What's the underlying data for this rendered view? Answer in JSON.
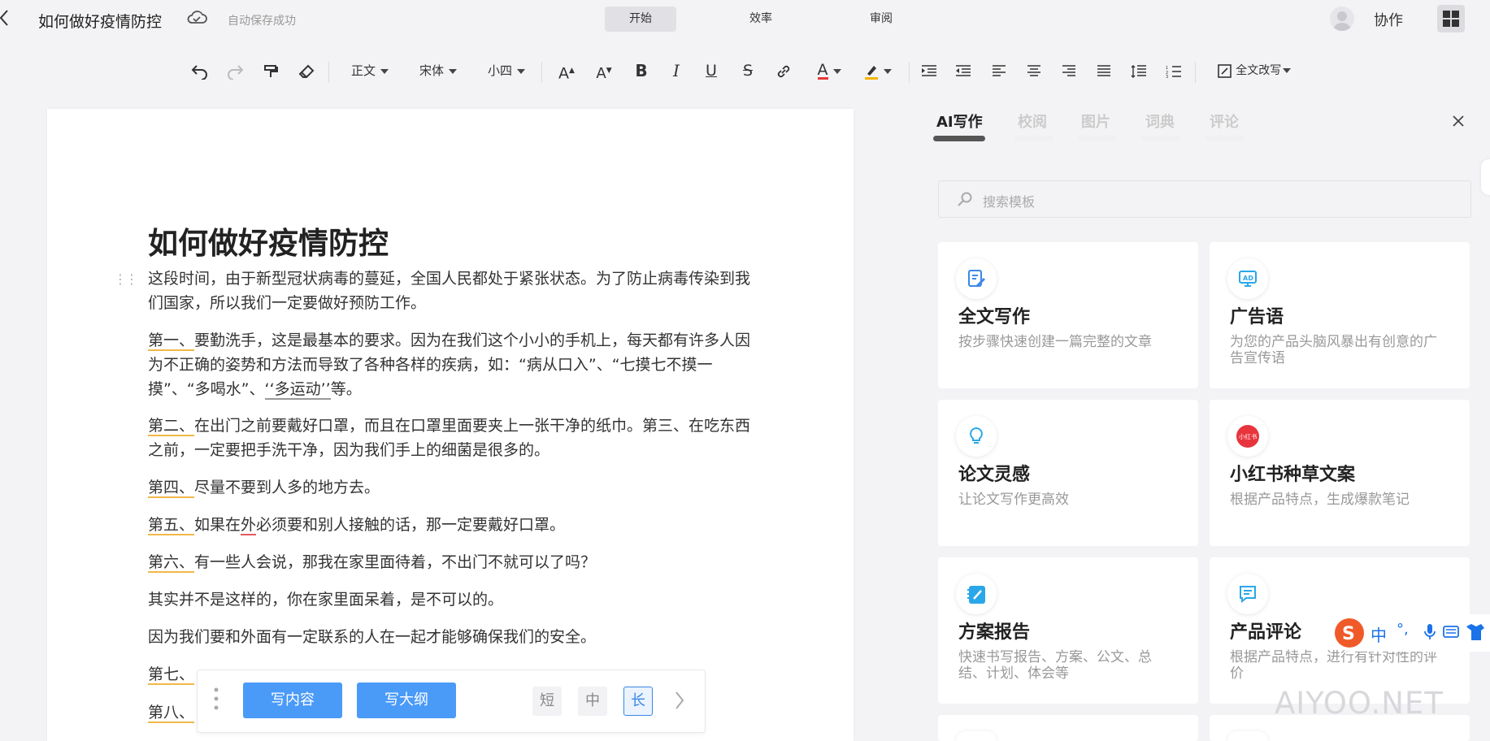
{
  "header": {
    "doc_title": "如何做好疫情防控",
    "save_status": "自动保存成功",
    "tabs": [
      "开始",
      "效率",
      "审阅"
    ],
    "collab": "协作"
  },
  "toolbar": {
    "style": "正文",
    "font": "宋体",
    "size": "小四",
    "rewrite": "全文改写",
    "font_color": "#e53935",
    "highlight_color": "#f5b400"
  },
  "document": {
    "title": "如何做好疫情防控",
    "p1": "这段时间，由于新型冠状病毒的蔓延，全国人民都处于紧张状态。为了防止病毒传染到我们国家，所以我们一定要做好预防工作。",
    "p2a": "第一、",
    "p2b": "要勤洗手，这是最基本的要求。因为在我们这个小小的手机上，每天都有许多人因为不正确的姿势和方法而导致了各种各样的疾病，如：“病从口入”、“七摸七不摸一摸”、“多喝水”、",
    "p2c": "‘‘多运动’’",
    "p2d": "等。",
    "p3a": "第二、",
    "p3b": "在出门之前要戴好口罩，而且在口罩里面要夹上一张干净的纸巾。第三、在吃东西之前，一定要把手洗干净，因为我们手上的细菌是很多的。",
    "p4a": "第四、",
    "p4b": "尽量不要到人多的地方去。",
    "p5a": "第五、",
    "p5b": "如果在",
    "p5c": "外",
    "p5d": "必须要和别人接触的话，那一定要戴好口罩。",
    "p6a": "第六、",
    "p6b": "有一些人会说，那我在家里面待着，不出门不就可以了吗？",
    "p7": "其实并不是这样的，你在家里面呆着，是不可以的。",
    "p8": "因为我们要和外面有一定联系的人在一起才能够确保我们的安全。",
    "p9": "第七、",
    "p10": "第八、"
  },
  "ai_bar": {
    "write_content": "写内容",
    "write_outline": "写大纲",
    "len_short": "短",
    "len_mid": "中",
    "len_long": "长"
  },
  "panel": {
    "tabs": [
      "AI写作",
      "校阅",
      "图片",
      "词典",
      "评论"
    ],
    "search_placeholder": "搜索模板",
    "cards": [
      {
        "title": "全文写作",
        "desc": "按步骤快速创建一篇完整的文章",
        "icon": "document-edit-icon"
      },
      {
        "title": "广告语",
        "desc": "为您的产品头脑风暴出有创意的广告宣传语",
        "icon": "ad-screen-icon"
      },
      {
        "title": "论文灵感",
        "desc": "让论文写作更高效",
        "icon": "lightbulb-icon"
      },
      {
        "title": "小红书种草文案",
        "desc": "根据产品特点，生成爆款笔记",
        "icon": "xiaohongshu-logo-icon"
      },
      {
        "title": "方案报告",
        "desc": "快速书写报告、方案、公文、总结、计划、体会等",
        "icon": "notebook-icon"
      },
      {
        "title": "产品评论",
        "desc": "根据产品特点，进行有针对性的评价",
        "icon": "comment-icon"
      }
    ],
    "xhs_logo_text": "小红书"
  },
  "ime": {
    "lang": "中",
    "punct": "°,"
  },
  "watermark": "AIYOO.NET"
}
